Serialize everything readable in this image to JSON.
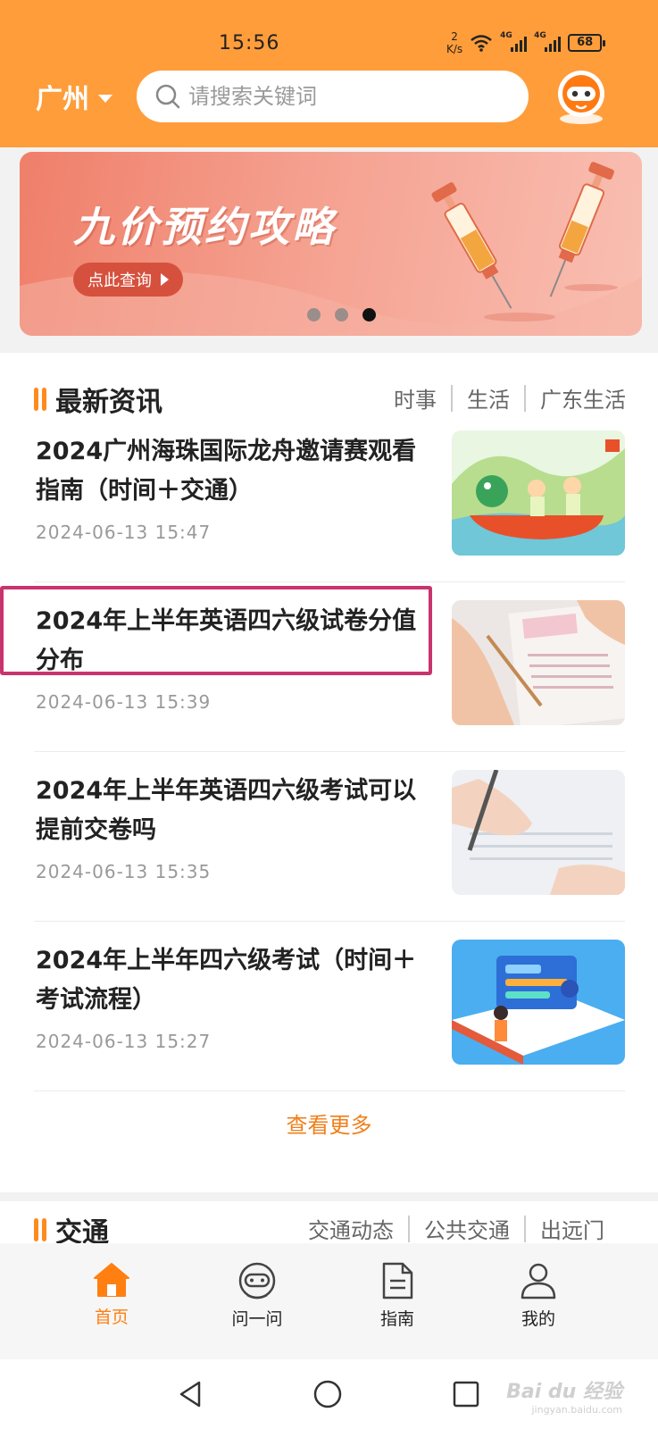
{
  "status": {
    "time": "15:56",
    "speed_value": "2",
    "speed_unit": "K/s",
    "net1": "4G",
    "net2": "4G",
    "battery": "68"
  },
  "header": {
    "city": "广州",
    "search_placeholder": "请搜索关键词",
    "accent": "#ff9d3a"
  },
  "banner": {
    "title": "九价预约攻略",
    "button_label": "点此查询",
    "dots": 3,
    "active_dot": 3
  },
  "news": {
    "section_title": "最新资讯",
    "tabs": [
      "时事",
      "生活",
      "广东生活"
    ],
    "items": [
      {
        "title": "2024广州海珠国际龙舟邀请赛观看指南（时间＋交通）",
        "time": "2024-06-13 15:47",
        "thumb": "dragon-boat-image"
      },
      {
        "title": "2024年上半年英语四六级试卷分值分布",
        "time": "2024-06-13 15:39",
        "thumb": "exam-paper-image"
      },
      {
        "title": "2024年上半年英语四六级考试可以提前交卷吗",
        "time": "2024-06-13 15:35",
        "thumb": "writing-hand-image"
      },
      {
        "title": "2024年上半年四六级考试（时间＋考试流程）",
        "time": "2024-06-13 15:27",
        "thumb": "study-illustration-image"
      }
    ],
    "more_label": "查看更多"
  },
  "traffic": {
    "section_title": "交通",
    "tabs": [
      "交通动态",
      "公共交通",
      "出远门"
    ]
  },
  "bottom_nav": [
    {
      "label": "首页",
      "icon": "home-icon",
      "active": true
    },
    {
      "label": "问一问",
      "icon": "robot-icon",
      "active": false
    },
    {
      "label": "指南",
      "icon": "document-icon",
      "active": false
    },
    {
      "label": "我的",
      "icon": "user-icon",
      "active": false
    }
  ],
  "watermark": {
    "brand": "Bai du 经验",
    "url": "jingyan.baidu.com"
  }
}
